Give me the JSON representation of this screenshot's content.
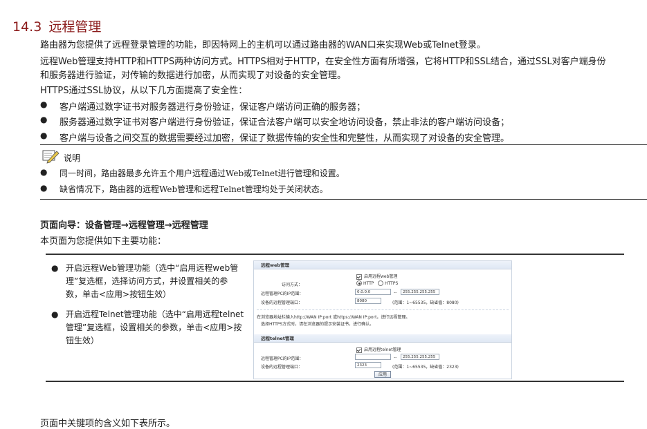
{
  "heading": {
    "number": "14.3",
    "title": "远程管理"
  },
  "intro": [
    "路由器为您提供了远程登录管理的功能，即因特网上的主机可以通过路由器的WAN口来实现Web或Telnet登录。",
    "远程Web管理支持HTTP和HTTPS两种访问方式。HTTPS相对于HTTP，在安全性方面有所增强，它将HTTP和SSL结合，通过SSL对客户端身份",
    "和服务器进行验证，对传输的数据进行加密，从而实现了对设备的安全管理。",
    "HTTPS通过SSL协议，从以下几方面提高了安全性："
  ],
  "bullets": [
    "客户端通过数字证书对服务器进行身份验证，保证客户端访问正确的服务器；",
    "服务器通过数字证书对客户端进行身份验证，保证合法客户端可以安全地访问设备，禁止非法的客户端访问设备；",
    "客户端与设备之间交互的数据需要经过加密，保证了数据传输的安全性和完整性，从而实现了对设备的安全管理。"
  ],
  "note": {
    "label": "说明",
    "items": [
      "同一时间，路由器最多允许五个用户远程通过Web或Telnet进行管理和设置。",
      "缺省情况下，路由器的远程Web管理和远程Telnet管理均处于关闭状态。"
    ]
  },
  "nav_path": "页面向导：设备管理→远程管理→远程管理",
  "nav_desc": "本页面为您提供如下主要功能：",
  "features": [
    [
      "开启远程Web管理功能（选中“启用远程web管",
      "理”复选框，选择访问方式，并设置相关的参",
      "数，单击<应用>按钮生效）"
    ],
    [
      "开启远程Telnet管理功能（选中“启用远程telnet",
      "管理”复选框，设置相关的参数，单击<应用>按",
      "钮生效）"
    ]
  ],
  "screenshot": {
    "web_section_title": "远程web管理",
    "web_enable_label": "启用远程web管理",
    "access_method_label": "访问方式：",
    "opt_http": "HTTP",
    "opt_https": "HTTPS",
    "pc_ip_label": "远程管理PC的IP范围：",
    "ip_start": "0.0.0.0",
    "ip_sep": "--",
    "ip_end": "255.255.255.255",
    "web_port_label": "设备的远程管理端口：",
    "web_port_value": "8080",
    "web_port_hint": "(范围：1~65535，缺省值：8080)",
    "tip1": "在浏览器地址栏输入http://WAN IP:port 或https://WAN IP:port，进行远程管理。",
    "tip2": "选择HTTPS方式时，请在浏览器的提示安装证书，进行确认。",
    "telnet_section_title": "远程telnet管理",
    "telnet_enable_label": "启用远程telnet管理",
    "telnet_ip_label": "远程管理PC的IP范围：",
    "telnet_ip_start": "",
    "telnet_ip_end": "255.255.255.255",
    "telnet_port_label": "设备的远程管理端口：",
    "telnet_port_value": "2323",
    "telnet_port_hint": "(范围：1~65535，缺省值：2323)",
    "apply_button": "应用"
  },
  "footer": "页面中关键项的含义如下表所示。"
}
